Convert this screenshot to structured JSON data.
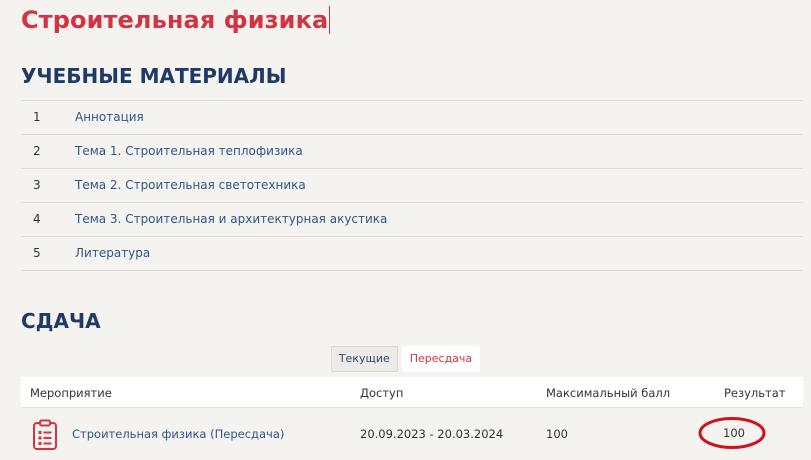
{
  "course": {
    "title": "Строительная физика"
  },
  "materials": {
    "heading": "УЧЕБНЫЕ МАТЕРИАЛЫ",
    "items": [
      {
        "num": "1",
        "label": "Аннотация"
      },
      {
        "num": "2",
        "label": "Тема 1. Строительная теплофизика"
      },
      {
        "num": "3",
        "label": "Тема 2. Строительная светотехника"
      },
      {
        "num": "4",
        "label": "Тема 3. Строительная и архитектурная акустика"
      },
      {
        "num": "5",
        "label": "Литература"
      }
    ]
  },
  "exam": {
    "heading": "СДАЧА",
    "tabs": [
      {
        "label": "Текущие",
        "active": false
      },
      {
        "label": "Пересдача",
        "active": true
      }
    ],
    "columns": {
      "event": "Мероприятие",
      "access": "Доступ",
      "max_score": "Максимальный балл",
      "result": "Результат"
    },
    "rows": [
      {
        "event": "Строительная физика (Пересдача)",
        "access": "20.09.2023 - 20.03.2024",
        "max_score": "100",
        "result": "100",
        "icon": "clipboard-list-icon"
      }
    ]
  },
  "colors": {
    "title_red": "#d33343",
    "heading_navy": "#1f3a66",
    "link_blue": "#2f5689",
    "annotation_red": "#d0101c"
  }
}
